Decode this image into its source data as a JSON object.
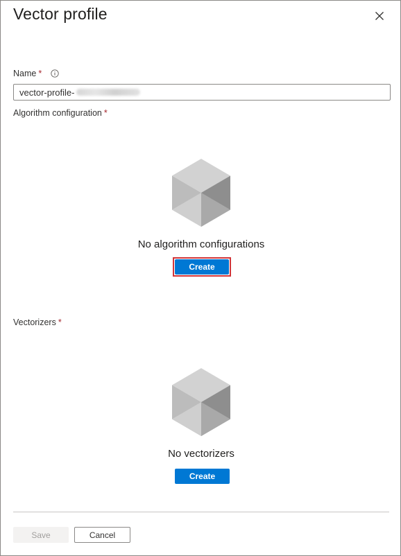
{
  "panel": {
    "title": "Vector profile"
  },
  "name_field": {
    "label": "Name",
    "required_mark": "*",
    "value": "vector-profile-"
  },
  "algorithm_section": {
    "label": "Algorithm configuration",
    "required_mark": "*",
    "empty_text": "No algorithm configurations",
    "create_label": "Create"
  },
  "vectorizers_section": {
    "label": "Vectorizers",
    "required_mark": "*",
    "empty_text": "No vectorizers",
    "create_label": "Create"
  },
  "footer": {
    "save_label": "Save",
    "cancel_label": "Cancel"
  },
  "icons": {
    "close": "close-icon",
    "info": "info-icon",
    "empty_state": "cube-icon"
  },
  "colors": {
    "primary": "#0078d4",
    "required": "#a4262c",
    "highlight": "#d13438"
  }
}
